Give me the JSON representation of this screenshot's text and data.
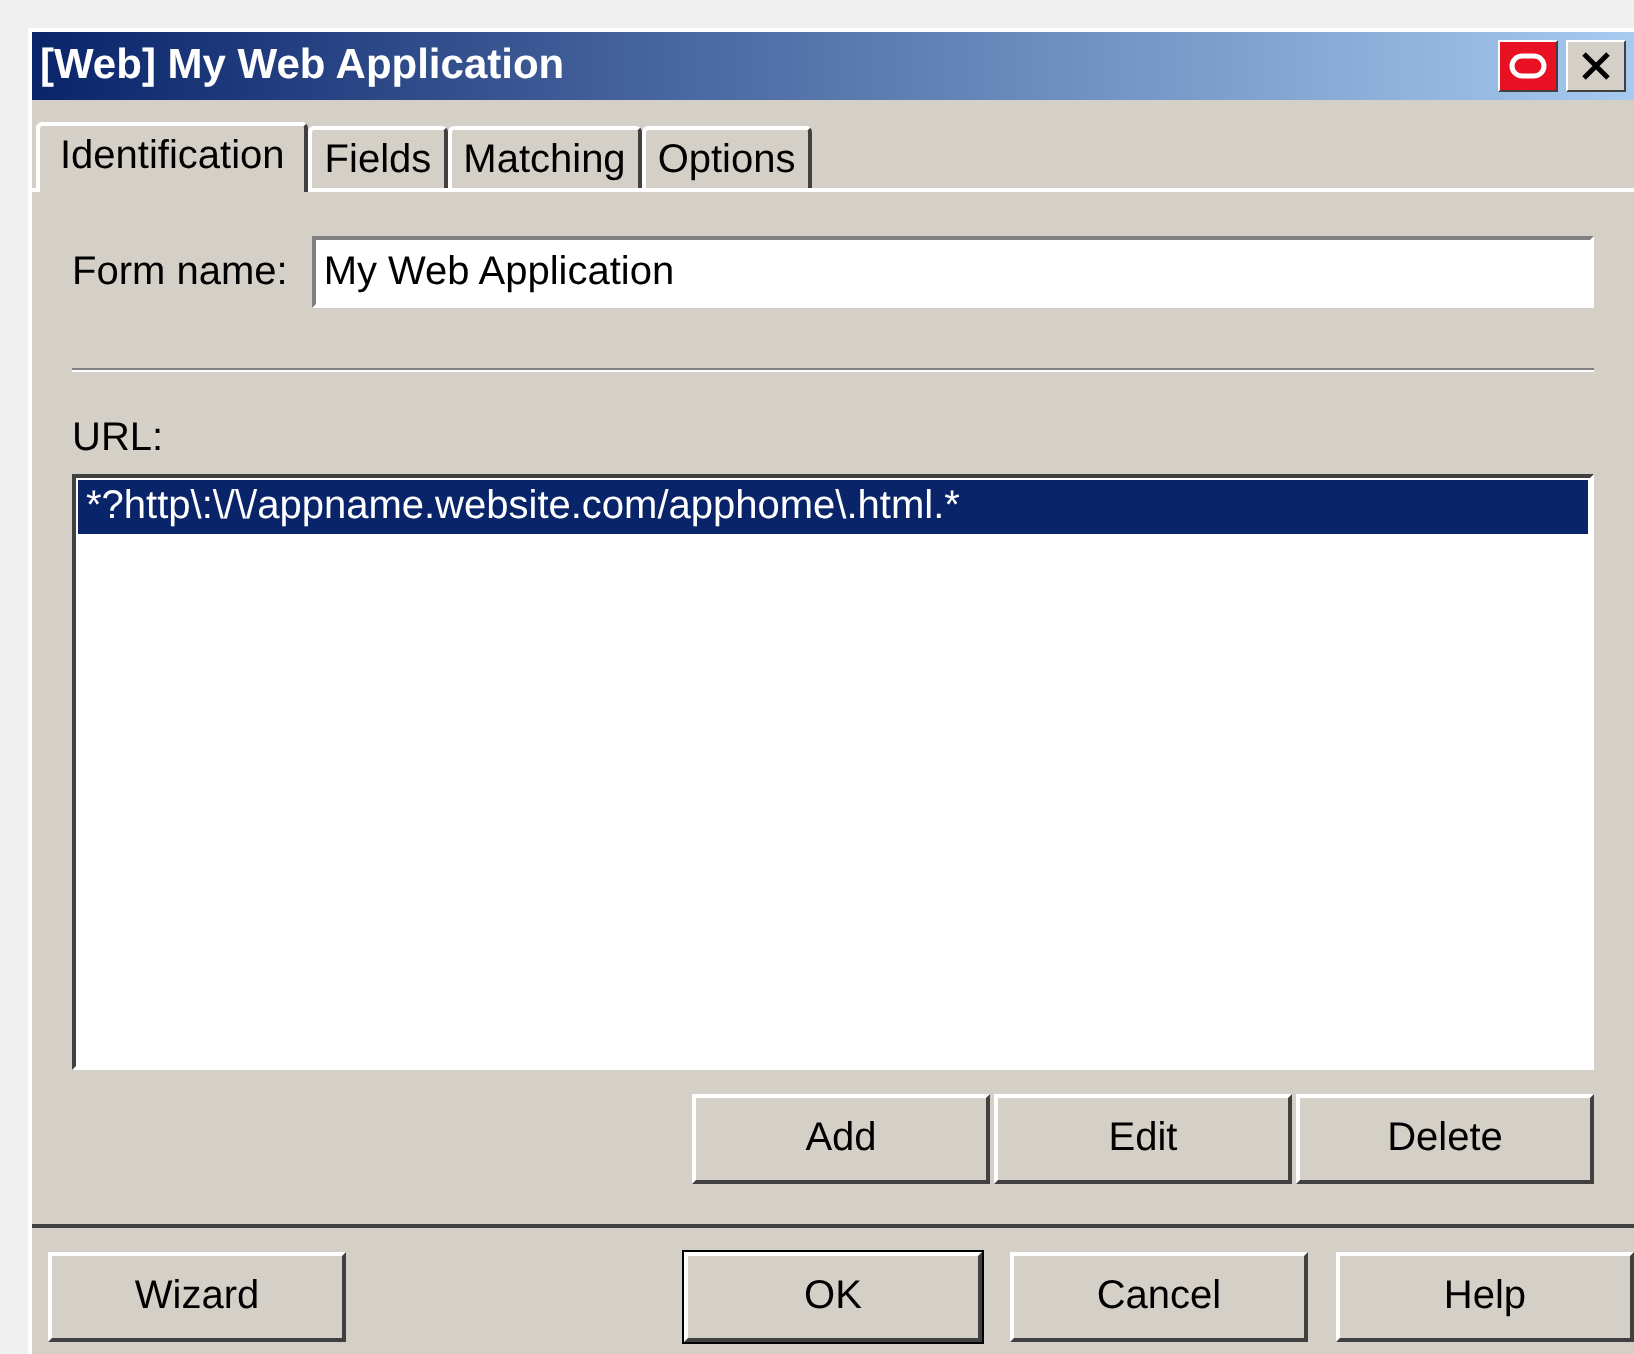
{
  "window": {
    "title": "[Web] My Web Application"
  },
  "tabs": [
    {
      "label": "Identification",
      "selected": true
    },
    {
      "label": "Fields",
      "selected": false
    },
    {
      "label": "Matching",
      "selected": false
    },
    {
      "label": "Options",
      "selected": false
    }
  ],
  "form_name": {
    "label": "Form name:",
    "value": "My Web Application"
  },
  "url": {
    "label": "URL:",
    "items": [
      {
        "text": "*?http\\:\\/\\/appname.website.com/apphome\\.html.*",
        "selected": true
      }
    ]
  },
  "list_buttons": [
    "Add",
    "Edit",
    "Delete"
  ],
  "footer_left": {
    "label": "Wizard",
    "default": false
  },
  "footer_buttons": [
    {
      "label": "OK",
      "default": true
    },
    {
      "label": "Cancel",
      "default": false
    },
    {
      "label": "Help",
      "default": false
    }
  ]
}
